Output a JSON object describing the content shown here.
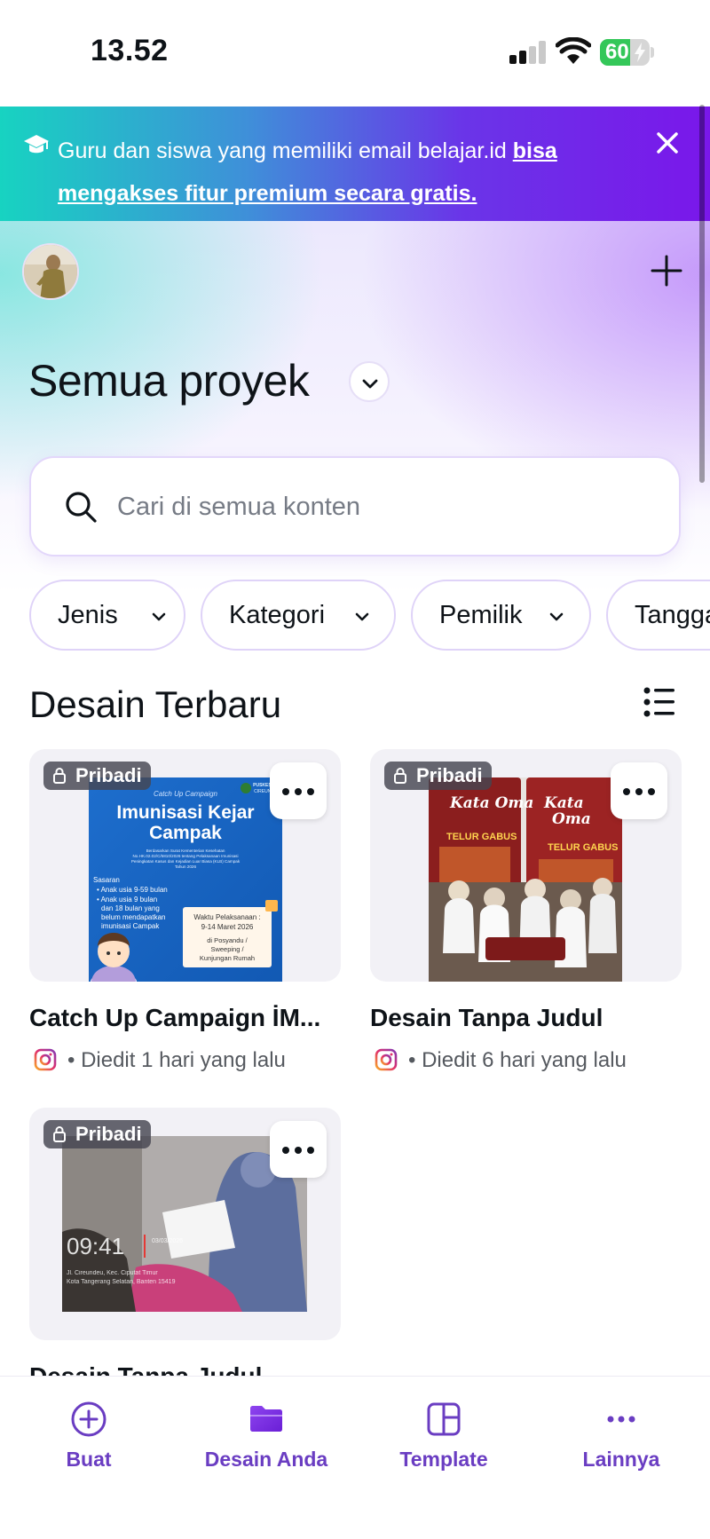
{
  "status_bar": {
    "time": "13.52",
    "battery": "60",
    "battery_level": 0.6
  },
  "banner": {
    "text": "Guru dan siswa yang memiliki email belajar.id",
    "link": "bisa mengakses fitur premium secara gratis.",
    "link_line1": "bisa",
    "link_line2": "mengakses fitur premium secara gratis."
  },
  "header": {
    "title": "Semua proyek"
  },
  "search": {
    "placeholder": "Cari di semua konten"
  },
  "filters": [
    "Jenis",
    "Kategori",
    "Pemilik",
    "Tanggal"
  ],
  "section": {
    "title": "Desain Terbaru"
  },
  "designs": [
    {
      "badge": "Pribadi",
      "title": "Catch Up Campaign İM...",
      "meta": "• Diedit 1 hari yang lalu",
      "thumb": {
        "small": "Catch Up Campaign",
        "heading": "Imunisasi Kejar Campak",
        "org": "PUSKESMAS CIREUNDEU",
        "decree": "Berdasarkan Surat Kementerian Kesehatan No. HK.02.02/C/5810/2026 tentang Pelaksanaan Imunisasi Kejar Campak dalam rangka Peningkatan Kasus dan Kejadian Luar Biasa (KLB) Campak Tahun 2026",
        "targets_label": "Sasaran",
        "targets": [
          "Anak usia 9-59 bulan",
          "Anak usia 9 bulan dan 18 bulan yang belum mendapatkan imunisasi Campak"
        ],
        "time_label": "Waktu Pelaksanaan :",
        "time_value": "9-14 Maret 2026",
        "place": "di Posyandu / Sweeping / Kunjungan Rumah"
      }
    },
    {
      "badge": "Pribadi",
      "title": "Desain Tanpa Judul",
      "meta": "• Diedit 6 hari yang lalu",
      "thumb": {
        "brand": "Kata Oma",
        "product": "TELUR GABUS"
      }
    },
    {
      "badge": "Pribadi",
      "title": "Desain Tanpa Judul",
      "thumb": {
        "clock": "09:41",
        "date": "03/03/2026",
        "address": "Jl. Cireundeu, Kec. Ciputat Timur, Kota Tangerang Selatan, Banten 15419"
      }
    }
  ],
  "tabs": [
    {
      "label": "Buat",
      "icon": "plus-circle-icon"
    },
    {
      "label": "Desain Anda",
      "icon": "folder-icon",
      "active": true
    },
    {
      "label": "Template",
      "icon": "template-icon"
    },
    {
      "label": "Lainnya",
      "icon": "more-dots-icon"
    }
  ],
  "colors": {
    "accent": "#6a3dc2",
    "banner_start": "#17d3c1",
    "banner_end": "#7a17ea",
    "instagram": "#e1306c"
  }
}
